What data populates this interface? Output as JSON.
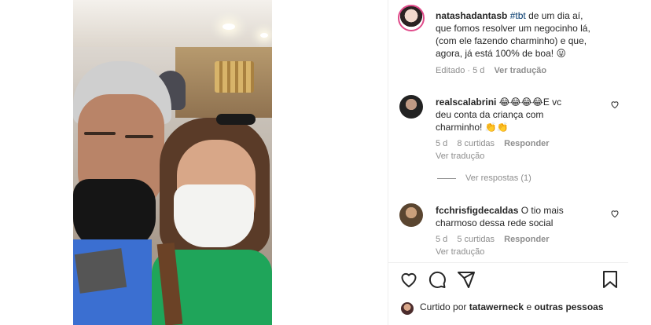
{
  "post": {
    "author": "natashadantasb",
    "hashtag": "#tbt",
    "caption_1": "de um dia aí,",
    "caption_2": "que fomos resolver um negocinho lá,",
    "caption_3": "(com ele fazendo charminho) e que,",
    "caption_4": "agora, já está 100% de boa! 😛",
    "edited": "Editado · 5 d",
    "translate": "Ver tradução"
  },
  "comments": [
    {
      "user": "realscalabrini",
      "text_1": "😂😂😂😂E vc",
      "text_2": "deu conta da criança com",
      "text_3": "charminho! 👏👏",
      "time": "5 d",
      "likes": "8 curtidas",
      "reply": "Responder",
      "translate": "Ver tradução"
    },
    {
      "user": "fcchrisfigdecaldas",
      "text_1": "O tio mais",
      "text_2": "charmoso dessa rede social",
      "time": "5 d",
      "likes": "5 curtidas",
      "reply": "Responder",
      "translate": "Ver tradução"
    }
  ],
  "view_replies": "Ver respostas (1)",
  "liked_by": {
    "prefix": "Curtido por",
    "user": "tatawerneck",
    "conj": "e",
    "others": "outras pessoas"
  },
  "icons": {
    "like": "heart-icon",
    "comment": "comment-icon",
    "share": "share-icon",
    "save": "bookmark-icon",
    "comment_like": "small-heart-icon"
  },
  "colors": {
    "text": "#262626",
    "muted": "#8e8e8e",
    "hashtag": "#00376b",
    "story_ring": "#e04b8a"
  }
}
